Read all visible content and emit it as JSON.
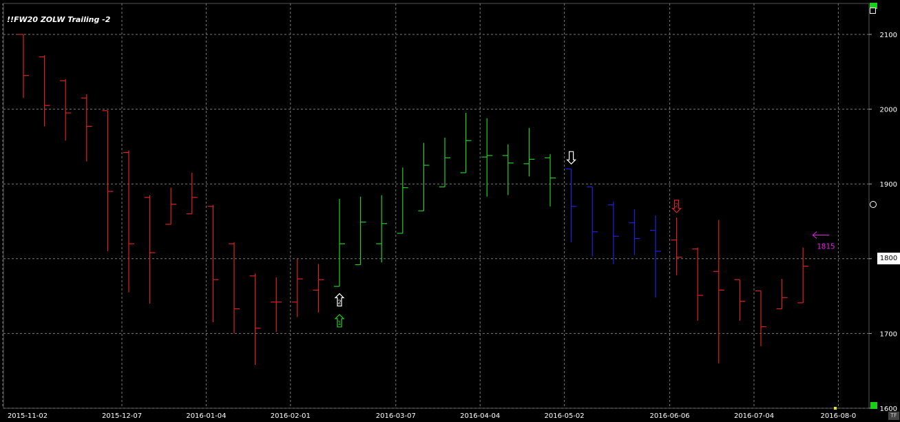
{
  "window": {
    "title": "!!FW20 ZOLW Trailing -2",
    "tf_badge": "TF"
  },
  "chart_data": {
    "type": "ohlc",
    "title": "!!FW20 ZOLW Trailing -2",
    "ylim": [
      1595,
      2130
    ],
    "yticks": [
      1600,
      1700,
      1800,
      1900,
      2000,
      2100
    ],
    "xticks": [
      {
        "i": 0,
        "label": "2015-11-02"
      },
      {
        "i": 5,
        "label": "2015-12-07"
      },
      {
        "i": 9,
        "label": "2016-01-04"
      },
      {
        "i": 13,
        "label": "2016-02-01"
      },
      {
        "i": 18,
        "label": "2016-03-07"
      },
      {
        "i": 22,
        "label": "2016-04-04"
      },
      {
        "i": 26,
        "label": "2016-05-02"
      },
      {
        "i": 31,
        "label": "2016-06-06"
      },
      {
        "i": 35,
        "label": "2016-07-04"
      },
      {
        "i": 39,
        "label": "2016-08-0"
      }
    ],
    "colors": {
      "red": "#e02020",
      "green": "#22d022",
      "blue": "#2020e0",
      "magenta": "#e020e0",
      "grid": "#7a7a7a"
    },
    "bars": [
      {
        "o": 2100,
        "h": 2100,
        "l": 2015,
        "c": 2045,
        "color": "red"
      },
      {
        "o": 2070,
        "h": 2072,
        "l": 1977,
        "c": 2005,
        "color": "red"
      },
      {
        "o": 2038,
        "h": 2040,
        "l": 1958,
        "c": 1995,
        "color": "red"
      },
      {
        "o": 2015,
        "h": 2020,
        "l": 1930,
        "c": 1977,
        "color": "red"
      },
      {
        "o": 1998,
        "h": 1998,
        "l": 1810,
        "c": 1890,
        "color": "red"
      },
      {
        "o": 1942,
        "h": 1945,
        "l": 1755,
        "c": 1820,
        "color": "red"
      },
      {
        "o": 1882,
        "h": 1885,
        "l": 1740,
        "c": 1808,
        "color": "red"
      },
      {
        "o": 1846,
        "h": 1895,
        "l": 1846,
        "c": 1873,
        "color": "red"
      },
      {
        "o": 1860,
        "h": 1915,
        "l": 1860,
        "c": 1882,
        "color": "red"
      },
      {
        "o": 1870,
        "h": 1872,
        "l": 1715,
        "c": 1772,
        "color": "red"
      },
      {
        "o": 1820,
        "h": 1822,
        "l": 1700,
        "c": 1733,
        "color": "red"
      },
      {
        "o": 1777,
        "h": 1780,
        "l": 1658,
        "c": 1707,
        "color": "red"
      },
      {
        "o": 1742,
        "h": 1775,
        "l": 1702,
        "c": 1742,
        "color": "red"
      },
      {
        "o": 1742,
        "h": 1800,
        "l": 1722,
        "c": 1773,
        "color": "red"
      },
      {
        "o": 1758,
        "h": 1793,
        "l": 1728,
        "c": 1772,
        "color": "red"
      },
      {
        "o": 1763,
        "h": 1880,
        "l": 1763,
        "c": 1820,
        "color": "green"
      },
      {
        "o": 1792,
        "h": 1883,
        "l": 1792,
        "c": 1849,
        "color": "green"
      },
      {
        "o": 1820,
        "h": 1885,
        "l": 1795,
        "c": 1847,
        "color": "green"
      },
      {
        "o": 1834,
        "h": 1922,
        "l": 1834,
        "c": 1895,
        "color": "green"
      },
      {
        "o": 1864,
        "h": 1955,
        "l": 1864,
        "c": 1925,
        "color": "green"
      },
      {
        "o": 1896,
        "h": 1962,
        "l": 1896,
        "c": 1935,
        "color": "green"
      },
      {
        "o": 1915,
        "h": 1995,
        "l": 1915,
        "c": 1958,
        "color": "green"
      },
      {
        "o": 1936,
        "h": 1988,
        "l": 1883,
        "c": 1938,
        "color": "green"
      },
      {
        "o": 1938,
        "h": 1953,
        "l": 1885,
        "c": 1928,
        "color": "green"
      },
      {
        "o": 1927,
        "h": 1975,
        "l": 1910,
        "c": 1933,
        "color": "green"
      },
      {
        "o": 1935,
        "h": 1940,
        "l": 1870,
        "c": 1908,
        "color": "green"
      },
      {
        "o": 1920,
        "h": 1920,
        "l": 1822,
        "c": 1870,
        "color": "blue"
      },
      {
        "o": 1896,
        "h": 1896,
        "l": 1803,
        "c": 1836,
        "color": "blue"
      },
      {
        "o": 1872,
        "h": 1876,
        "l": 1793,
        "c": 1830,
        "color": "blue"
      },
      {
        "o": 1848,
        "h": 1866,
        "l": 1805,
        "c": 1827,
        "color": "blue"
      },
      {
        "o": 1838,
        "h": 1858,
        "l": 1748,
        "c": 1810,
        "color": "blue"
      },
      {
        "o": 1825,
        "h": 1855,
        "l": 1778,
        "c": 1802,
        "color": "red"
      },
      {
        "o": 1813,
        "h": 1815,
        "l": 1717,
        "c": 1751,
        "color": "red"
      },
      {
        "o": 1783,
        "h": 1852,
        "l": 1660,
        "c": 1758,
        "color": "red"
      },
      {
        "o": 1772,
        "h": 1772,
        "l": 1717,
        "c": 1743,
        "color": "red"
      },
      {
        "o": 1757,
        "h": 1757,
        "l": 1683,
        "c": 1709,
        "color": "red"
      },
      {
        "o": 1733,
        "h": 1773,
        "l": 1733,
        "c": 1748,
        "color": "red"
      },
      {
        "o": 1741,
        "h": 1815,
        "l": 1741,
        "c": 1790,
        "color": "red"
      }
    ],
    "markers": [
      {
        "i": 15,
        "dir": "up",
        "color": "#ffffff",
        "label": "2",
        "price": 1745
      },
      {
        "i": 15,
        "dir": "up",
        "color": "#22d022",
        "label": "1",
        "price": 1717
      },
      {
        "i": 26,
        "dir": "down",
        "color": "#ffffff",
        "label": "",
        "price": 1935
      },
      {
        "i": 31,
        "dir": "down",
        "color": "#e02020",
        "label": "2",
        "price": 1870
      }
    ],
    "last_value": {
      "i": 37,
      "value": 1815,
      "label": "1815",
      "color": "#e020e0"
    },
    "current_price_label": "1800",
    "grid": true
  }
}
